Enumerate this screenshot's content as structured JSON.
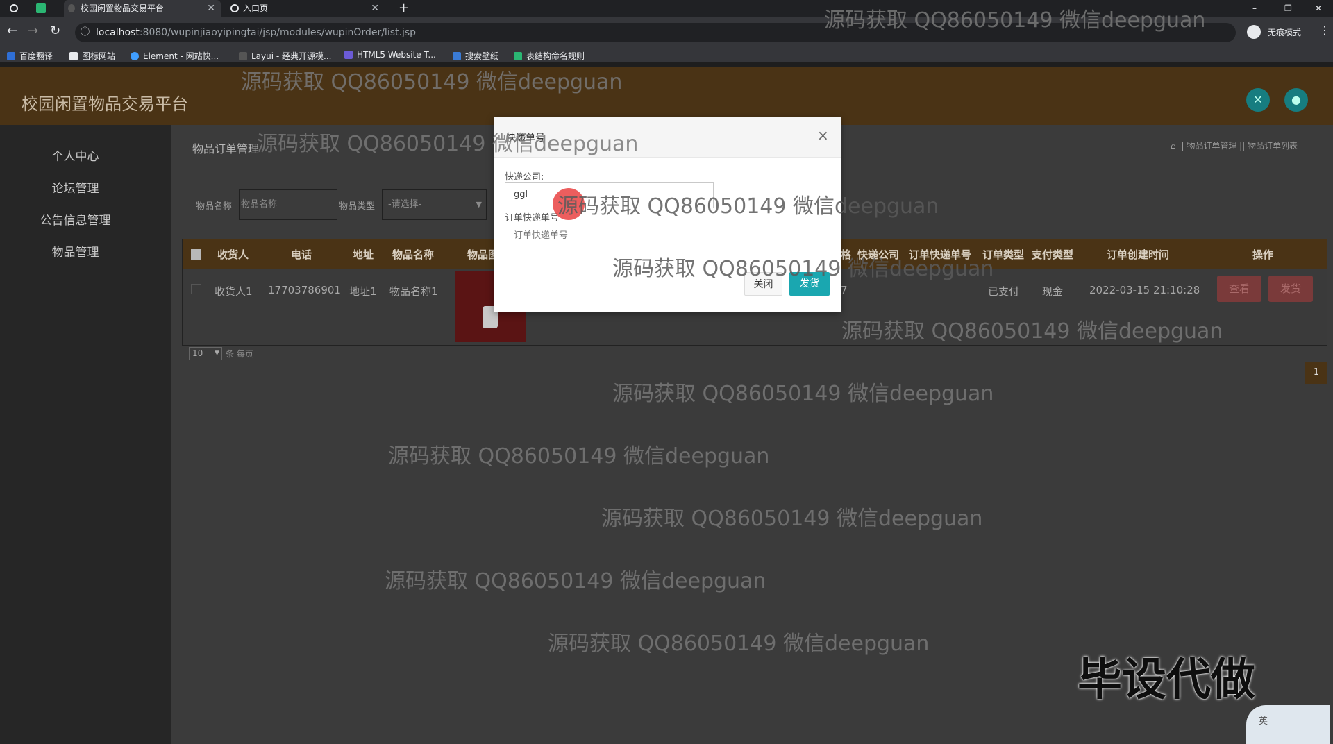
{
  "browser": {
    "tabs": [
      {
        "label": "校园闲置物品交易平台",
        "active": true
      },
      {
        "label": "入口页",
        "active": false
      }
    ],
    "new_tab": "+",
    "url_host": "localhost",
    "url_path": ":8080/wupinjiaoyipingtai/jsp/modules/wupinOrder/list.jsp",
    "profile_label": "无痕模式",
    "bookmarks": [
      "百度翻译",
      "图标网站",
      "Element - 网站快...",
      "Layui - 经典开源模...",
      "HTML5 Website T...",
      "搜索壁纸",
      "表结构命名规则"
    ],
    "window_controls": [
      "–",
      "❐",
      "✕"
    ]
  },
  "app": {
    "title": "校园闲置物品交易平台",
    "sidebar": [
      "个人中心",
      "论坛管理",
      "公告信息管理",
      "物品管理"
    ],
    "page_title": "物品订单管理",
    "breadcrumb": "|| 物品订单管理 || 物品订单列表",
    "filters": {
      "name_label": "物品名称",
      "name_placeholder": "物品名称",
      "type_label": "物品类型",
      "type_value": "-请选择-"
    },
    "table": {
      "headers": [
        "收货人",
        "电话",
        "地址",
        "物品名称",
        "物品图",
        "格",
        "快递公司",
        "订单快递单号",
        "订单类型",
        "支付类型",
        "订单创建时间",
        "操作"
      ],
      "rows": [
        {
          "consignee": "收货人1",
          "phone": "17703786901",
          "address": "地址1",
          "item_name": "物品名称1",
          "price_fragment": "7",
          "order_type": "已支付",
          "pay_type": "现金",
          "created": "2022-03-15 21:10:28",
          "view_btn": "查看",
          "ship_btn": "发货"
        }
      ]
    },
    "page_size": "10",
    "page_size_suffix": "条 每页",
    "current_page": "1"
  },
  "modal": {
    "title": "快递单号",
    "close": "×",
    "express_label": "快递公司:",
    "express_value": "ggl",
    "tracking_label": "订单快递单号",
    "tracking_placeholder": "订单快递单号",
    "cancel": "关闭",
    "confirm": "发货"
  },
  "overlay_texts": {
    "watermark": "源码获取 QQ86050149 微信deepguan",
    "promo": "毕设代做",
    "ime": "英"
  },
  "colors": {
    "header": "#4a3315",
    "accent": "#1aa7b0",
    "danger": "#7a3a3a"
  }
}
